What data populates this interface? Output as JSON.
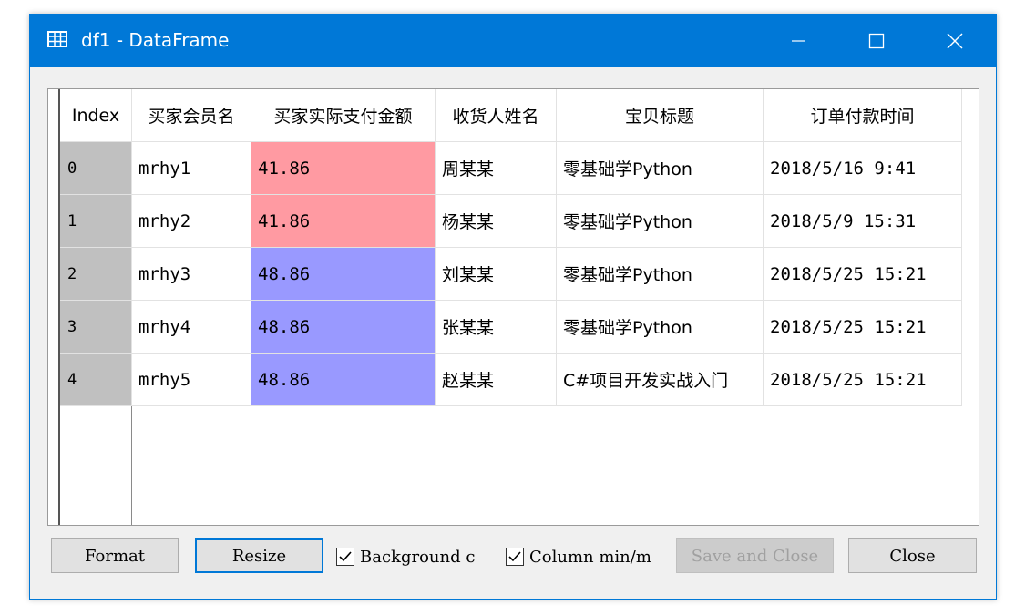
{
  "window": {
    "title": "df1 - DataFrame",
    "accent_color": "#0078d7",
    "controls": {
      "minimize_icon": "minimize-icon",
      "maximize_icon": "maximize-icon",
      "close_icon": "close-icon"
    }
  },
  "table": {
    "columns": [
      "Index",
      "买家会员名",
      "买家实际支付金额",
      "收货人姓名",
      "宝贝标题",
      "订单付款时间"
    ],
    "rows": [
      [
        "0",
        "mrhy1",
        "41.86",
        "周某某",
        "零基础学Python",
        "2018/5/16 9:41"
      ],
      [
        "1",
        "mrhy2",
        "41.86",
        "杨某某",
        "零基础学Python",
        "2018/5/9 15:31"
      ],
      [
        "2",
        "mrhy3",
        "48.86",
        "刘某某",
        "零基础学Python",
        "2018/5/25 15:21"
      ],
      [
        "3",
        "mrhy4",
        "48.86",
        "张某某",
        "零基础学Python",
        "2018/5/25 15:21"
      ],
      [
        "4",
        "mrhy5",
        "48.86",
        "赵某某",
        "C#项目开发实战入门",
        "2018/5/25 15:21"
      ]
    ],
    "amount_colors": [
      "#ff9aa2",
      "#ff9aa2",
      "#9999ff",
      "#9999ff",
      "#9999ff"
    ],
    "index_bg_color": "#c0c0c0"
  },
  "buttons": {
    "format": "Format",
    "resize": "Resize",
    "save_close": "Save and Close",
    "close": "Close"
  },
  "checkboxes": {
    "background": {
      "label": "Background c",
      "checked": true
    },
    "column_minmax": {
      "label": "Column min/m",
      "checked": true
    }
  }
}
